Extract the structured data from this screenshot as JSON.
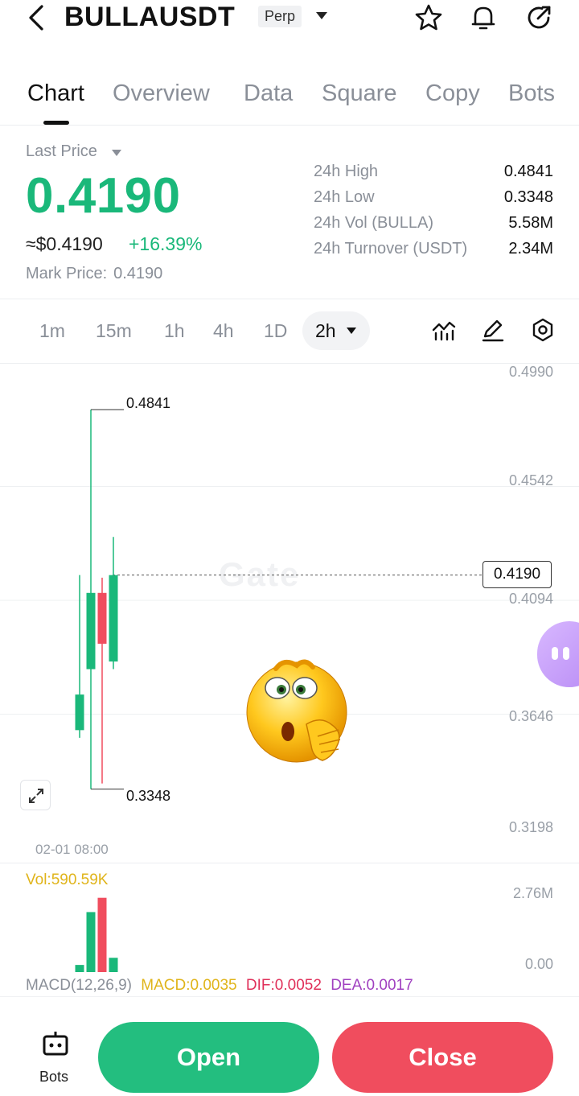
{
  "header": {
    "symbol": "BULLAUSDT",
    "contract_type": "Perp",
    "icons": [
      "back-arrow-icon",
      "star-icon",
      "bell-icon",
      "share-icon"
    ]
  },
  "tabs": [
    {
      "label": "Chart",
      "active": true
    },
    {
      "label": "Overview",
      "active": false
    },
    {
      "label": "Data",
      "active": false
    },
    {
      "label": "Square",
      "active": false
    },
    {
      "label": "Copy",
      "active": false
    },
    {
      "label": "Bots",
      "active": false
    }
  ],
  "price": {
    "last_price_label": "Last Price",
    "last_price": "0.4190",
    "usd_price": "≈$0.4190",
    "change": "+16.39%",
    "mark_label": "Mark Price:",
    "mark_value": "0.4190",
    "up_color": "#1ab87a"
  },
  "stats": [
    {
      "label": "24h  High",
      "value": "0.4841"
    },
    {
      "label": "24h  Low",
      "value": "0.3348"
    },
    {
      "label": "24h  Vol (BULLA)",
      "value": "5.58M"
    },
    {
      "label": "24h  Turnover (USDT)",
      "value": "2.34M"
    }
  ],
  "intervals": [
    "1m",
    "15m",
    "1h",
    "4h",
    "1D"
  ],
  "active_interval": "2h",
  "toolbar_icons": [
    "indicators-icon",
    "draw-pencil-icon",
    "settings-hex-icon"
  ],
  "chart": {
    "y_axis": [
      "0.4990",
      "0.4542",
      "0.4094",
      "0.3646",
      "0.3198"
    ],
    "current_price_tag": "0.4190",
    "high_annotation": "0.4841",
    "low_annotation": "0.3348",
    "watermark": "Gate",
    "date_label": "02-01 08:00",
    "up_color": "#1ab87a",
    "down_color": "#f04d5e"
  },
  "chart_data": {
    "type": "candlestick",
    "ylim": [
      0.3198,
      0.499
    ],
    "y_ticks": [
      0.499,
      0.4542,
      0.4094,
      0.3646,
      0.3198
    ],
    "candles": [
      {
        "open": 0.358,
        "close": 0.372,
        "high": 0.419,
        "low": 0.355
      },
      {
        "open": 0.382,
        "close": 0.412,
        "high": 0.4841,
        "low": 0.3348
      },
      {
        "open": 0.412,
        "close": 0.392,
        "high": 0.418,
        "low": 0.337
      },
      {
        "open": 0.385,
        "close": 0.419,
        "high": 0.434,
        "low": 0.382
      }
    ],
    "volume": {
      "label": "Vol:590.59K",
      "y_ticks": [
        "2.76M",
        "0.00"
      ],
      "ylim": [
        0,
        2.76
      ],
      "values": [
        0.25,
        2.1,
        2.6,
        0.5
      ],
      "colors": [
        "up",
        "up",
        "down",
        "up"
      ]
    },
    "macd": {
      "label": "MACD(12,26,9)",
      "macd": "MACD:0.0035",
      "dif": "DIF:0.0052",
      "dea": "DEA:0.0017"
    }
  },
  "bottom": {
    "bots_label": "Bots",
    "open_label": "Open",
    "close_label": "Close"
  }
}
